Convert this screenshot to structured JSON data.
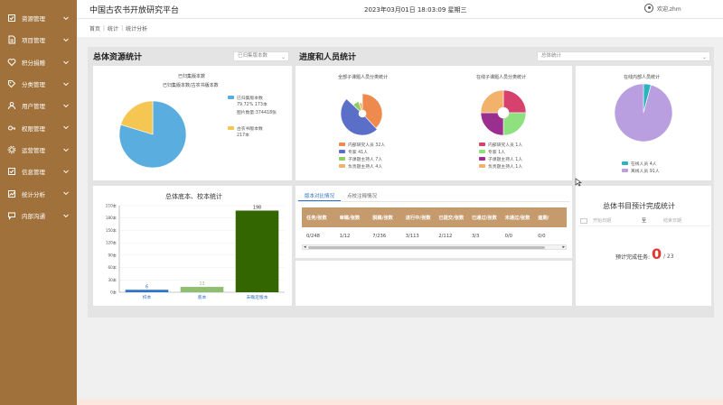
{
  "app": {
    "title": "中国古农书开放研究平台",
    "datetime": "2023年03月01日 18:03:09 星期三",
    "user": "欢迎,zhm"
  },
  "sidebar": {
    "items": [
      {
        "label": "资源管理",
        "icon": "checklist-icon"
      },
      {
        "label": "项目管理",
        "icon": "document-icon"
      },
      {
        "label": "积分捐赠",
        "icon": "heart-icon"
      },
      {
        "label": "分类管理",
        "icon": "tag-icon"
      },
      {
        "label": "用户管理",
        "icon": "user-icon"
      },
      {
        "label": "权限管理",
        "icon": "key-icon"
      },
      {
        "label": "运营管理",
        "icon": "gear-icon"
      },
      {
        "label": "信息管理",
        "icon": "checklist-icon"
      },
      {
        "label": "统计分析",
        "icon": "chart-icon"
      },
      {
        "label": "内部沟通",
        "icon": "chat-icon"
      }
    ]
  },
  "breadcrumb": [
    "首页",
    "统计",
    "统计分析"
  ],
  "resource": {
    "title": "总体资源统计",
    "select": "已归集版本数",
    "chart_title": "已归集版本数",
    "chart_subtitle": "已归集版本数/古农书版本数",
    "legend": [
      {
        "label": "已归集版本数",
        "sub": "79.72% 173本",
        "color": "#5aaddf"
      },
      {
        "label": "古农书版本数",
        "sub": "217本",
        "color": "#f6c652"
      }
    ],
    "page_count": "图片数量:374418张"
  },
  "progress": {
    "title": "进度和人员统计",
    "select": "总体统计"
  },
  "all_people": {
    "title": "全部子课题人员分类统计",
    "legend": [
      {
        "label": "内部研究人员 32人",
        "color": "#ef8a4e"
      },
      {
        "label": "专家 41人",
        "color": "#5b6fc8"
      },
      {
        "label": "子课题主持人 7人",
        "color": "#8fcf62"
      },
      {
        "label": "负责题主持人 4人",
        "color": "#f3b26b"
      }
    ]
  },
  "sub_people": {
    "title": "在线子课题人员分类统计",
    "legend": [
      {
        "label": "内部研究人员 1人",
        "color": "#d6416d"
      },
      {
        "label": "专家 1人",
        "color": "#8fe07e"
      },
      {
        "label": "子课题主持人 1人",
        "color": "#9b2f8f"
      },
      {
        "label": "负责题主持人 1人",
        "color": "#f3b26b"
      }
    ]
  },
  "internal": {
    "title": "在线内部人员统计",
    "legend": [
      {
        "label": "在线人员 4人",
        "color": "#2bb3c0"
      },
      {
        "label": "离线人员 91人",
        "color": "#b99ee0"
      }
    ]
  },
  "books": {
    "title": "总体底本、校本统计"
  },
  "tabs": [
    "版本对比情况",
    "点校注释情况"
  ],
  "table": {
    "headers": [
      "任务/张数",
      "审稿/张数",
      "脱稿/张数",
      "进行中/张数",
      "已提交/张数",
      "已通过/张数",
      "未通过/张数",
      "逾期/"
    ],
    "row": [
      "0/248",
      "1/12",
      "7/236",
      "3/113",
      "2/112",
      "3/3",
      "0/0",
      "0/0"
    ]
  },
  "budget": {
    "title": "总体书目预计完成统计",
    "start_ph": "开始日期",
    "sep": "至",
    "end_ph": "结束日期",
    "label": "预计完成任务:",
    "value": "0",
    "total": "/ 23"
  },
  "chart_data": [
    {
      "type": "pie",
      "title": "已归集版本数",
      "subtitle": "已归集版本数/古农书版本数",
      "labels": [
        "已归集版本数",
        "古农书版本数"
      ],
      "values": [
        173,
        44
      ],
      "colors": [
        "#5aaddf",
        "#f6c652"
      ]
    },
    {
      "type": "pie",
      "title": "全部子课题人员分类统计",
      "labels": [
        "内部研究人员",
        "专家",
        "子课题主持人",
        "负责题主持人"
      ],
      "values": [
        32,
        41,
        7,
        4
      ],
      "colors": [
        "#ef8a4e",
        "#5b6fc8",
        "#8fcf62",
        "#f3b26b"
      ]
    },
    {
      "type": "pie",
      "title": "在线子课题人员分类统计",
      "labels": [
        "内部研究人员",
        "专家",
        "子课题主持人",
        "负责题主持人"
      ],
      "values": [
        1,
        1,
        1,
        1
      ],
      "colors": [
        "#d6416d",
        "#8fe07e",
        "#9b2f8f",
        "#f3b26b"
      ]
    },
    {
      "type": "pie",
      "title": "在线内部人员统计",
      "labels": [
        "在线人员",
        "离线人员"
      ],
      "values": [
        4,
        91
      ],
      "colors": [
        "#2bb3c0",
        "#b99ee0"
      ]
    },
    {
      "type": "bar",
      "title": "总体底本、校本统计",
      "categories": [
        "校本",
        "底本",
        "未确定版本"
      ],
      "values": [
        6,
        13,
        198
      ],
      "colors": [
        "#2f73c4",
        "#8fbe72",
        "#336600"
      ],
      "ylim": [
        0,
        210
      ],
      "yticks": [
        "0本",
        "30本",
        "60本",
        "90本",
        "120本",
        "150本",
        "180本",
        "210本"
      ]
    }
  ]
}
